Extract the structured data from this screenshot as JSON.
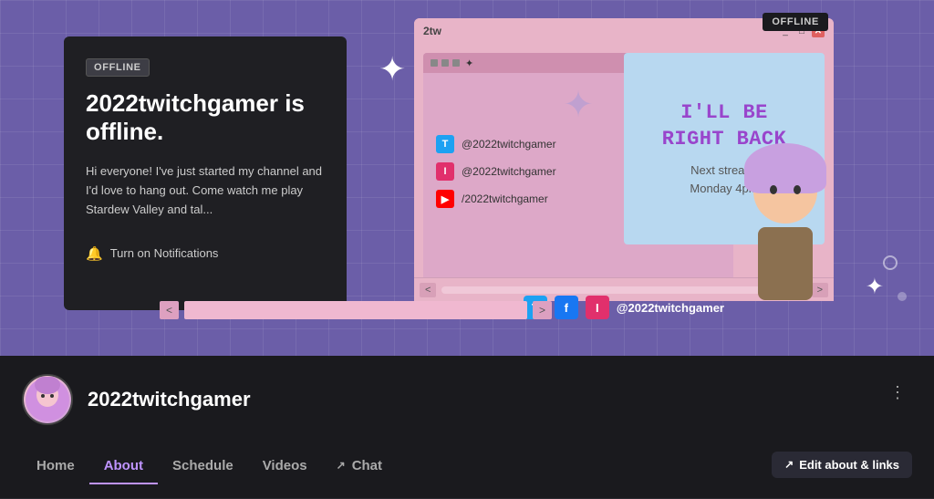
{
  "banner": {
    "offline_badge": "OFFLINE",
    "offline_title": "2022twitchgamer is offline.",
    "offline_desc": "Hi everyone! I've just started my channel and I'd love to hang out. Come watch me play Stardew Valley and tal...",
    "notif_label": "Turn on Notifications",
    "top_offline_badge": "OFFLINE",
    "social_handle": "@2022twitchgamer"
  },
  "back_card": {
    "line1": "I'LL BE",
    "line2": "RIGHT BACK",
    "next_stream": "Next stream:",
    "next_time": "Monday 4pm"
  },
  "inner_window": {
    "twitter": "@2022twitchgamer",
    "instagram": "@2022twitchgamer",
    "youtube": "/2022twitchgamer"
  },
  "channel": {
    "name": "2022twitchgamer"
  },
  "nav": {
    "home": "Home",
    "about": "About",
    "schedule": "Schedule",
    "videos": "Videos",
    "chat": "Chat"
  },
  "edit_btn": {
    "label": "Edit about & links",
    "arrow": "↗"
  },
  "more_icon": "•••"
}
